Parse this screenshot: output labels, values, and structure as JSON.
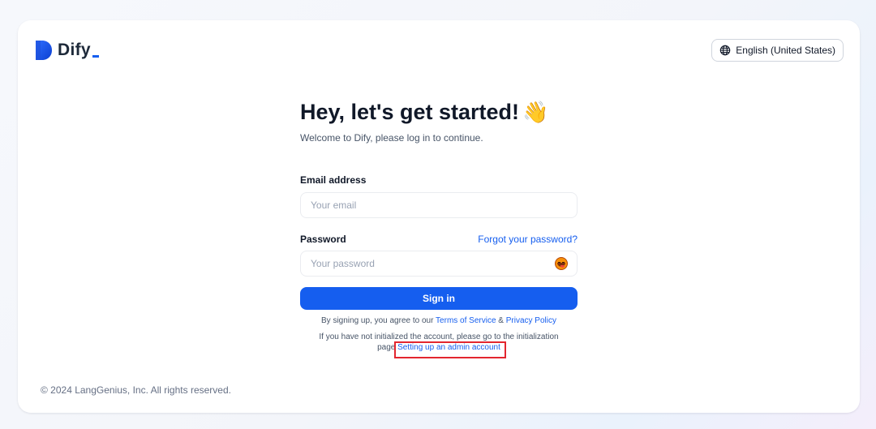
{
  "brand": {
    "name": "Dify",
    "accent": "#155eef"
  },
  "header": {
    "language_label": "English (United States)",
    "language_icon": "globe-icon"
  },
  "form": {
    "title": "Hey, let's get started!",
    "title_emoji": "👋",
    "subtitle": "Welcome to Dify, please log in to continue.",
    "email_label": "Email address",
    "email_placeholder": "Your email",
    "password_label": "Password",
    "forgot_label": "Forgot your password?",
    "password_placeholder": "Your password",
    "toggle_icon": "emoji-toggle-icon",
    "signin_label": "Sign in",
    "terms_prefix": "By signing up, you agree to our",
    "terms_link": "Terms of Service",
    "terms_joiner": "&",
    "privacy_link": "Privacy Policy",
    "init_text": "If you have not initialized the account, please go to the initialization page",
    "init_link": "Setting up an admin account"
  },
  "footer": {
    "copyright": "© 2024 LangGenius, Inc. All rights reserved."
  },
  "annotation": {
    "highlight_color": "#e3262f"
  }
}
